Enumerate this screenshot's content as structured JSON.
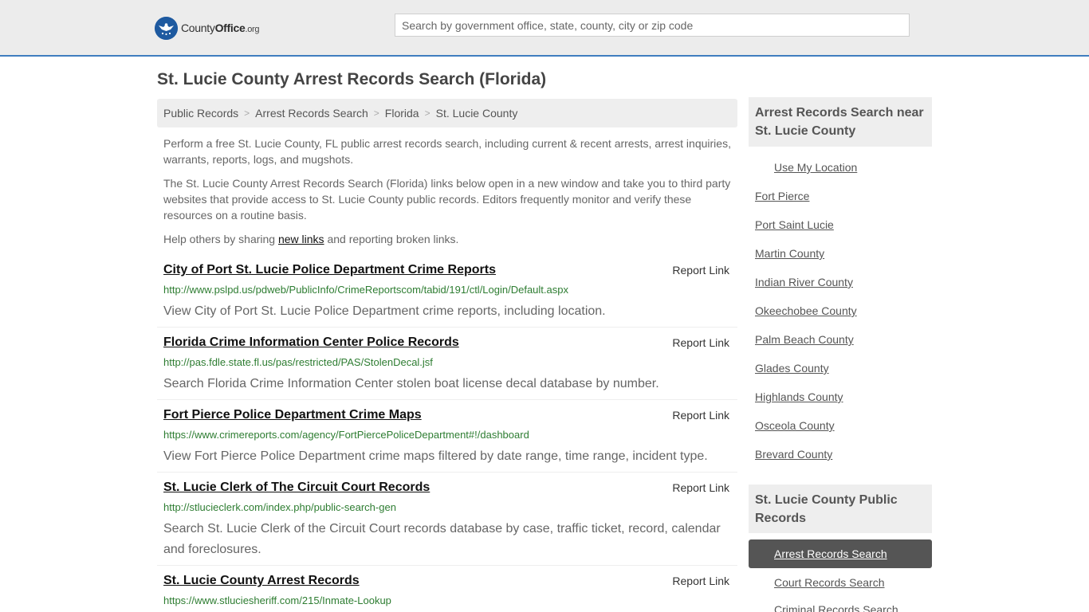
{
  "header": {
    "logo_brand": "County",
    "logo_office": "Office",
    "logo_tld": ".org",
    "search_placeholder": "Search by government office, state, county, city or zip code"
  },
  "page_title": "St. Lucie County Arrest Records Search (Florida)",
  "breadcrumb": [
    "Public Records",
    "Arrest Records Search",
    "Florida",
    "St. Lucie County"
  ],
  "intro": {
    "p1": "Perform a free St. Lucie County, FL public arrest records search, including current & recent arrests, arrest inquiries, warrants, reports, logs, and mugshots.",
    "p2": "The St. Lucie County Arrest Records Search (Florida) links below open in a new window and take you to third party websites that provide access to St. Lucie County public records. Editors frequently monitor and verify these resources on a routine basis.",
    "p3_before": "Help others by sharing ",
    "p3_link": "new links",
    "p3_after": " and reporting broken links."
  },
  "report_label": "Report Link",
  "results": [
    {
      "title": "City of Port St. Lucie Police Department Crime Reports",
      "url": "http://www.pslpd.us/pdweb/PublicInfo/CrimeReportscom/tabid/191/ctl/Login/Default.aspx",
      "desc": "View City of Port St. Lucie Police Department crime reports, including location."
    },
    {
      "title": "Florida Crime Information Center Police Records",
      "url": "http://pas.fdle.state.fl.us/pas/restricted/PAS/StolenDecal.jsf",
      "desc": "Search Florida Crime Information Center stolen boat license decal database by number."
    },
    {
      "title": "Fort Pierce Police Department Crime Maps",
      "url": "https://www.crimereports.com/agency/FortPiercePoliceDepartment#!/dashboard",
      "desc": "View Fort Pierce Police Department crime maps filtered by date range, time range, incident type."
    },
    {
      "title": "St. Lucie Clerk of The Circuit Court Records",
      "url": "http://stlucieclerk.com/index.php/public-search-gen",
      "desc": "Search St. Lucie Clerk of the Circuit Court records database by case, traffic ticket, record, calendar and foreclosures."
    },
    {
      "title": "St. Lucie County Arrest Records",
      "url": "https://www.stluciesheriff.com/215/Inmate-Lookup",
      "desc": ""
    }
  ],
  "sidebar": {
    "nearby_heading": "Arrest Records Search near St. Lucie County",
    "use_location": "Use My Location",
    "nearby": [
      "Fort Pierce",
      "Port Saint Lucie",
      "Martin County",
      "Indian River County",
      "Okeechobee County",
      "Palm Beach County",
      "Glades County",
      "Highlands County",
      "Osceola County",
      "Brevard County"
    ],
    "public_heading": "St. Lucie County Public Records",
    "public_links": [
      "Arrest Records Search",
      "Court Records Search",
      "Criminal Records Search"
    ]
  },
  "colors": {
    "header_bg": "#ececec",
    "header_border": "#3f7dbf",
    "url_green": "#2e7d32",
    "active_bg": "#555555"
  }
}
